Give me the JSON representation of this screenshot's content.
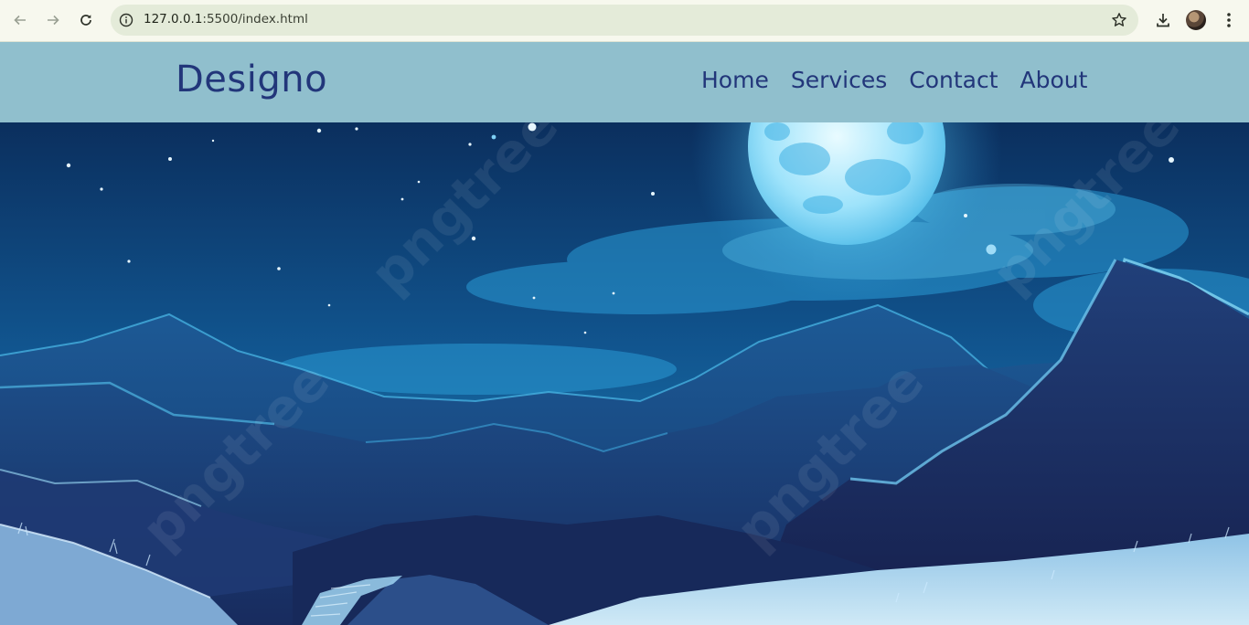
{
  "browser": {
    "url_host": "127.0.0.1",
    "url_rest": ":5500/index.html",
    "icons": {
      "back": "arrow-left-icon",
      "forward": "arrow-right-icon",
      "reload": "reload-icon",
      "site_info": "info-icon",
      "bookmark": "star-icon",
      "download": "download-icon",
      "profile": "avatar",
      "menu": "kebab-menu-icon"
    }
  },
  "site": {
    "logo": "Designo",
    "nav": [
      "Home",
      "Services",
      "Contact",
      "About"
    ],
    "colors": {
      "header_bg": "#90bfcd",
      "nav_text": "#22367a"
    }
  },
  "hero": {
    "image_description_visible": "night sky with full moon over blue mountains and a path",
    "watermark": "pngtree"
  }
}
